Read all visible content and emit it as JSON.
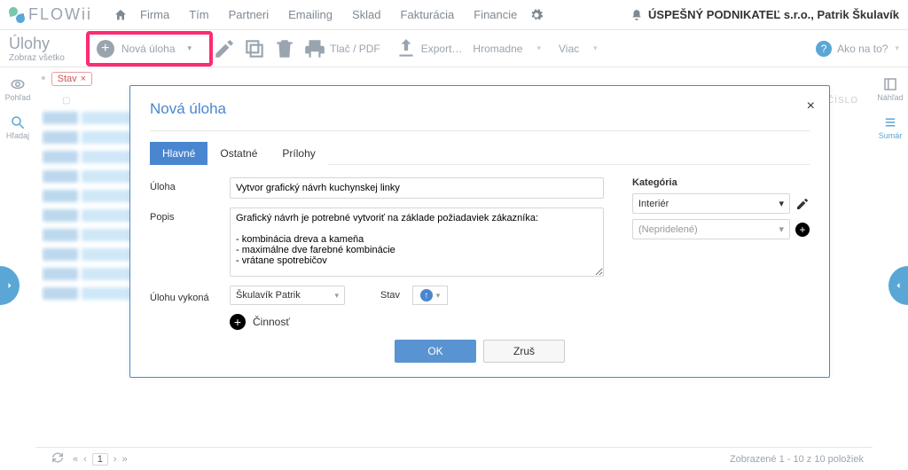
{
  "brand": "FLOWii",
  "nav": {
    "items": [
      "Firma",
      "Tím",
      "Partneri",
      "Emailing",
      "Sklad",
      "Fakturácia",
      "Financie"
    ]
  },
  "company_line": "ÚSPEŠNÝ PODNIKATEĽ s.r.o., Patrik Škulavík",
  "page": {
    "title": "Úlohy",
    "subtitle": "Zobraz všetko"
  },
  "toolbar": {
    "new_task": "Nová úloha",
    "print": "Tlač / PDF",
    "export": "Export…",
    "bulk": "Hromadne",
    "more": "Viac",
    "help": "Ako na to?"
  },
  "leftrail": {
    "view": "Pohľad",
    "search": "Hľadaj"
  },
  "rightrail": {
    "preview": "Náhľad",
    "summary": "Sumár"
  },
  "tag": "Stav",
  "grid_head_num": "ČÍSLO",
  "modal": {
    "title": "Nová úloha",
    "tabs": {
      "main": "Hlavné",
      "other": "Ostatné",
      "attach": "Prílohy"
    },
    "labels": {
      "task": "Úloha",
      "desc": "Popis",
      "assignee": "Úlohu vykoná",
      "status": "Stav",
      "category": "Kategória",
      "activity": "Činnosť"
    },
    "values": {
      "task": "Vytvor grafický návrh kuchynskej linky",
      "desc": "Grafický návrh je potrebné vytvoriť na základe požiadaviek zákazníka:\n\n- kombinácia dreva a kameňa\n- maximálne dve farebné kombinácie\n- vrátane spotrebičov",
      "assignee": "Škulavík Patrik",
      "category": "Interiér",
      "category2": "(Nepridelené)"
    },
    "buttons": {
      "ok": "OK",
      "cancel": "Zruš"
    }
  },
  "footer": {
    "page_current": "1",
    "counter": "Zobrazené 1 - 10 z 10 položiek"
  }
}
